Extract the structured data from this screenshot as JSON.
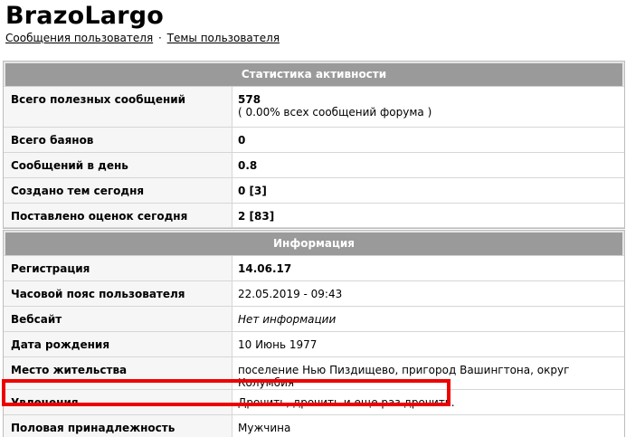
{
  "profile": {
    "username": "BrazoLargo",
    "links": [
      {
        "label": "Сообщения пользователя"
      },
      {
        "label": "Темы пользователя"
      }
    ],
    "link_separator": "·"
  },
  "activity": {
    "header": "Статистика активности",
    "rows": [
      {
        "label": "Всего полезных сообщений",
        "value": "578",
        "sub": "( 0.00% всех сообщений форума )"
      },
      {
        "label": "Всего баянов",
        "value": "0"
      },
      {
        "label": "Сообщений в день",
        "value": "0.8"
      },
      {
        "label": "Создано тем сегодня",
        "value": "0 [3]"
      },
      {
        "label": "Поставлено оценок сегодня",
        "value": "2 [83]"
      }
    ]
  },
  "info": {
    "header": "Информация",
    "rows": [
      {
        "label": "Регистрация",
        "value": "14.06.17"
      },
      {
        "label": "Часовой пояс пользователя",
        "value": "22.05.2019 - 09:43"
      },
      {
        "label": "Вебсайт",
        "value": "Нет информации"
      },
      {
        "label": "Дата рождения",
        "value": "10 Июнь 1977"
      },
      {
        "label": "Место жительства",
        "value": "поселение Нью Пиздищево, пригород Вашингтона, округ Колумбия"
      },
      {
        "label": "Увлечения",
        "value": "Дрочить, дрочить и еще раз дрочить."
      },
      {
        "label": "Половая принадлежность",
        "value": "Мужчина"
      }
    ]
  },
  "colors": {
    "header_bg": "#9a9a9a",
    "highlight": "#ee0000"
  }
}
